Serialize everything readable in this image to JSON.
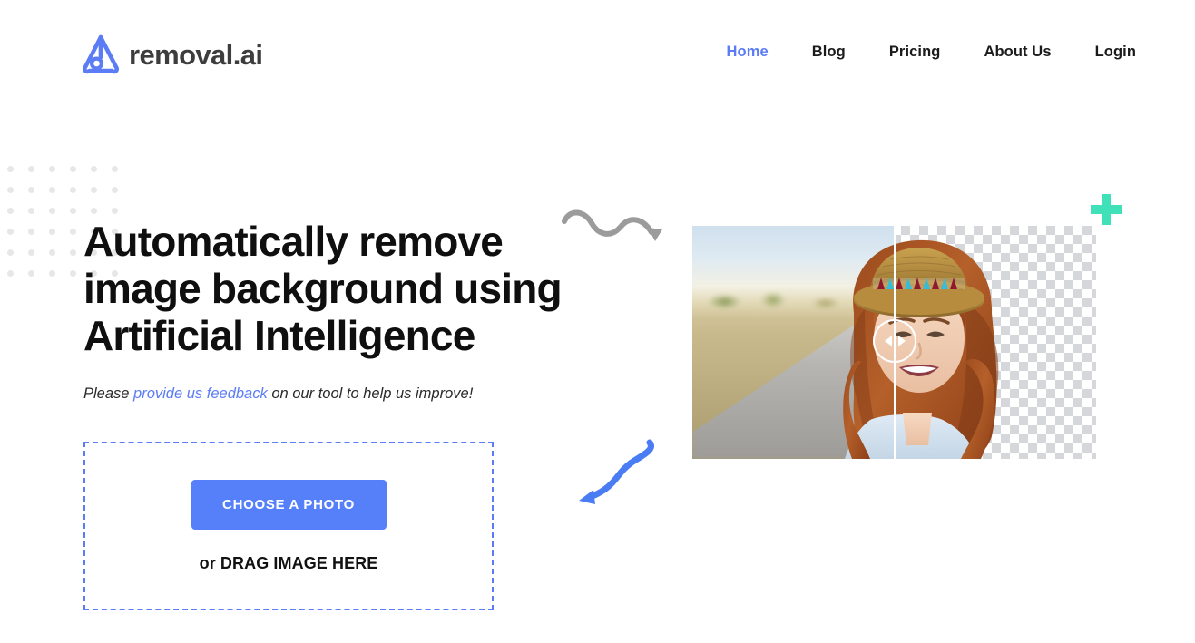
{
  "header": {
    "logo": {
      "icon": "removal-ai-logo-icon",
      "text": "removal.ai"
    },
    "nav": [
      {
        "label": "Home",
        "active": true
      },
      {
        "label": "Blog",
        "active": false
      },
      {
        "label": "Pricing",
        "active": false
      },
      {
        "label": "About Us",
        "active": false
      },
      {
        "label": "Login",
        "active": false
      }
    ]
  },
  "hero": {
    "headline_line1": "Automatically remove",
    "headline_line2": "image background using",
    "headline_line3": "Artificial Intelligence",
    "sub_prefix": "Please ",
    "sub_link": "provide us feedback",
    "sub_suffix": " on our tool to help us improve!"
  },
  "upload": {
    "button_label": "CHOOSE A PHOTO",
    "drag_text": "or DRAG IMAGE HERE"
  },
  "decor": {
    "arrow_gray": "wavy-arrow-right-icon",
    "arrow_blue": "curved-arrow-left-icon",
    "plus": "plus-icon",
    "dots": "dot-grid-pattern",
    "dot_rows": 6,
    "dot_cols": 6
  },
  "comparison": {
    "before_alt": "woman-with-hat-on-road-original",
    "after_alt": "woman-with-hat-background-removed",
    "handle_icon": "slider-handle-icon",
    "divider_position_pct": 50
  },
  "colors": {
    "accent_blue": "#5b7cf5",
    "button_blue": "#5680f9",
    "plus_green": "#40e0b8",
    "logo_gray": "#3d3d3d",
    "dot_gray": "#e7e7ea",
    "text_dark": "#0f0f10"
  }
}
